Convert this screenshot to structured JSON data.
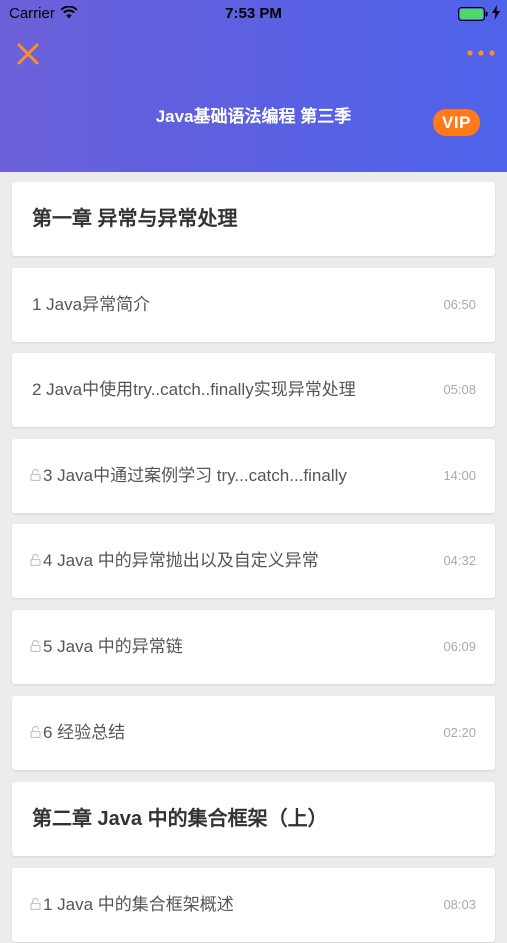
{
  "status_bar": {
    "carrier": "Carrier",
    "time": "7:53 PM"
  },
  "header": {
    "title": "Java基础语法编程 第三季",
    "vip_label": "VIP",
    "close_icon": "close-icon",
    "more_icon": "more-icon"
  },
  "colors": {
    "accent": "#ff8c2a",
    "header_start": "#6d61d9",
    "header_end": "#4e63ea"
  },
  "list": [
    {
      "type": "chapter",
      "title": "第一章 异常与异常处理"
    },
    {
      "type": "lesson",
      "title": "1 Java异常简介",
      "duration": "06:50",
      "locked": false
    },
    {
      "type": "lesson",
      "title": "2 Java中使用try..catch..finally实现异常处理",
      "duration": "05:08",
      "locked": false
    },
    {
      "type": "lesson",
      "title": "3 Java中通过案例学习 try...catch...finally",
      "duration": "14:00",
      "locked": true
    },
    {
      "type": "lesson",
      "title": "4 Java 中的异常抛出以及自定义异常",
      "duration": "04:32",
      "locked": true
    },
    {
      "type": "lesson",
      "title": "5 Java 中的异常链",
      "duration": "06:09",
      "locked": true
    },
    {
      "type": "lesson",
      "title": "6 经验总结",
      "duration": "02:20",
      "locked": true
    },
    {
      "type": "chapter",
      "title": "第二章 Java 中的集合框架（上）"
    },
    {
      "type": "lesson",
      "title": "1 Java 中的集合框架概述",
      "duration": "08:03",
      "locked": true
    }
  ]
}
